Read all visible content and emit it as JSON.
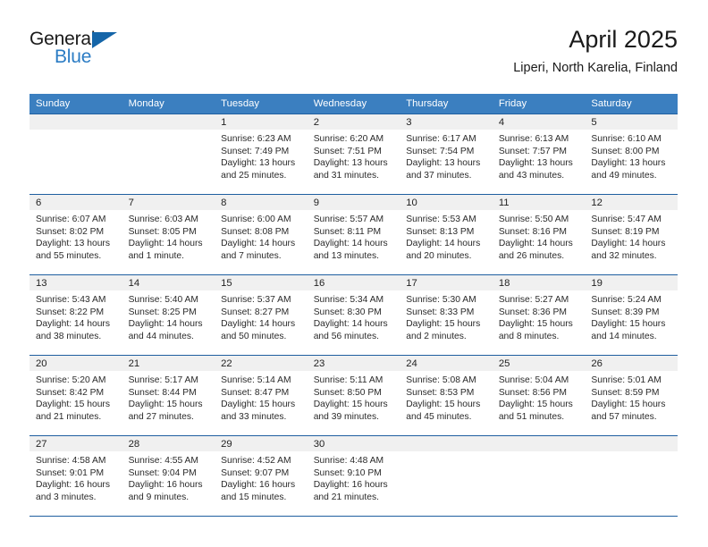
{
  "brand": {
    "name_part1": "General",
    "name_part2": "Blue",
    "triangle_icon": "triangle-icon",
    "accent_blue": "#2b7cc4",
    "triangle_blue": "#1565a8"
  },
  "header": {
    "title": "April 2025",
    "subtitle": "Liperi, North Karelia, Finland"
  },
  "calendar": {
    "header_bg": "#3b7fc0",
    "row_border": "#1f5fa0",
    "daynum_bg": "#f0f0f0",
    "weekdays": [
      "Sunday",
      "Monday",
      "Tuesday",
      "Wednesday",
      "Thursday",
      "Friday",
      "Saturday"
    ],
    "weeks": [
      [
        {
          "day": "",
          "sunrise": "",
          "sunset": "",
          "daylight1": "",
          "daylight2": ""
        },
        {
          "day": "",
          "sunrise": "",
          "sunset": "",
          "daylight1": "",
          "daylight2": ""
        },
        {
          "day": "1",
          "sunrise": "Sunrise: 6:23 AM",
          "sunset": "Sunset: 7:49 PM",
          "daylight1": "Daylight: 13 hours",
          "daylight2": "and 25 minutes."
        },
        {
          "day": "2",
          "sunrise": "Sunrise: 6:20 AM",
          "sunset": "Sunset: 7:51 PM",
          "daylight1": "Daylight: 13 hours",
          "daylight2": "and 31 minutes."
        },
        {
          "day": "3",
          "sunrise": "Sunrise: 6:17 AM",
          "sunset": "Sunset: 7:54 PM",
          "daylight1": "Daylight: 13 hours",
          "daylight2": "and 37 minutes."
        },
        {
          "day": "4",
          "sunrise": "Sunrise: 6:13 AM",
          "sunset": "Sunset: 7:57 PM",
          "daylight1": "Daylight: 13 hours",
          "daylight2": "and 43 minutes."
        },
        {
          "day": "5",
          "sunrise": "Sunrise: 6:10 AM",
          "sunset": "Sunset: 8:00 PM",
          "daylight1": "Daylight: 13 hours",
          "daylight2": "and 49 minutes."
        }
      ],
      [
        {
          "day": "6",
          "sunrise": "Sunrise: 6:07 AM",
          "sunset": "Sunset: 8:02 PM",
          "daylight1": "Daylight: 13 hours",
          "daylight2": "and 55 minutes."
        },
        {
          "day": "7",
          "sunrise": "Sunrise: 6:03 AM",
          "sunset": "Sunset: 8:05 PM",
          "daylight1": "Daylight: 14 hours",
          "daylight2": "and 1 minute."
        },
        {
          "day": "8",
          "sunrise": "Sunrise: 6:00 AM",
          "sunset": "Sunset: 8:08 PM",
          "daylight1": "Daylight: 14 hours",
          "daylight2": "and 7 minutes."
        },
        {
          "day": "9",
          "sunrise": "Sunrise: 5:57 AM",
          "sunset": "Sunset: 8:11 PM",
          "daylight1": "Daylight: 14 hours",
          "daylight2": "and 13 minutes."
        },
        {
          "day": "10",
          "sunrise": "Sunrise: 5:53 AM",
          "sunset": "Sunset: 8:13 PM",
          "daylight1": "Daylight: 14 hours",
          "daylight2": "and 20 minutes."
        },
        {
          "day": "11",
          "sunrise": "Sunrise: 5:50 AM",
          "sunset": "Sunset: 8:16 PM",
          "daylight1": "Daylight: 14 hours",
          "daylight2": "and 26 minutes."
        },
        {
          "day": "12",
          "sunrise": "Sunrise: 5:47 AM",
          "sunset": "Sunset: 8:19 PM",
          "daylight1": "Daylight: 14 hours",
          "daylight2": "and 32 minutes."
        }
      ],
      [
        {
          "day": "13",
          "sunrise": "Sunrise: 5:43 AM",
          "sunset": "Sunset: 8:22 PM",
          "daylight1": "Daylight: 14 hours",
          "daylight2": "and 38 minutes."
        },
        {
          "day": "14",
          "sunrise": "Sunrise: 5:40 AM",
          "sunset": "Sunset: 8:25 PM",
          "daylight1": "Daylight: 14 hours",
          "daylight2": "and 44 minutes."
        },
        {
          "day": "15",
          "sunrise": "Sunrise: 5:37 AM",
          "sunset": "Sunset: 8:27 PM",
          "daylight1": "Daylight: 14 hours",
          "daylight2": "and 50 minutes."
        },
        {
          "day": "16",
          "sunrise": "Sunrise: 5:34 AM",
          "sunset": "Sunset: 8:30 PM",
          "daylight1": "Daylight: 14 hours",
          "daylight2": "and 56 minutes."
        },
        {
          "day": "17",
          "sunrise": "Sunrise: 5:30 AM",
          "sunset": "Sunset: 8:33 PM",
          "daylight1": "Daylight: 15 hours",
          "daylight2": "and 2 minutes."
        },
        {
          "day": "18",
          "sunrise": "Sunrise: 5:27 AM",
          "sunset": "Sunset: 8:36 PM",
          "daylight1": "Daylight: 15 hours",
          "daylight2": "and 8 minutes."
        },
        {
          "day": "19",
          "sunrise": "Sunrise: 5:24 AM",
          "sunset": "Sunset: 8:39 PM",
          "daylight1": "Daylight: 15 hours",
          "daylight2": "and 14 minutes."
        }
      ],
      [
        {
          "day": "20",
          "sunrise": "Sunrise: 5:20 AM",
          "sunset": "Sunset: 8:42 PM",
          "daylight1": "Daylight: 15 hours",
          "daylight2": "and 21 minutes."
        },
        {
          "day": "21",
          "sunrise": "Sunrise: 5:17 AM",
          "sunset": "Sunset: 8:44 PM",
          "daylight1": "Daylight: 15 hours",
          "daylight2": "and 27 minutes."
        },
        {
          "day": "22",
          "sunrise": "Sunrise: 5:14 AM",
          "sunset": "Sunset: 8:47 PM",
          "daylight1": "Daylight: 15 hours",
          "daylight2": "and 33 minutes."
        },
        {
          "day": "23",
          "sunrise": "Sunrise: 5:11 AM",
          "sunset": "Sunset: 8:50 PM",
          "daylight1": "Daylight: 15 hours",
          "daylight2": "and 39 minutes."
        },
        {
          "day": "24",
          "sunrise": "Sunrise: 5:08 AM",
          "sunset": "Sunset: 8:53 PM",
          "daylight1": "Daylight: 15 hours",
          "daylight2": "and 45 minutes."
        },
        {
          "day": "25",
          "sunrise": "Sunrise: 5:04 AM",
          "sunset": "Sunset: 8:56 PM",
          "daylight1": "Daylight: 15 hours",
          "daylight2": "and 51 minutes."
        },
        {
          "day": "26",
          "sunrise": "Sunrise: 5:01 AM",
          "sunset": "Sunset: 8:59 PM",
          "daylight1": "Daylight: 15 hours",
          "daylight2": "and 57 minutes."
        }
      ],
      [
        {
          "day": "27",
          "sunrise": "Sunrise: 4:58 AM",
          "sunset": "Sunset: 9:01 PM",
          "daylight1": "Daylight: 16 hours",
          "daylight2": "and 3 minutes."
        },
        {
          "day": "28",
          "sunrise": "Sunrise: 4:55 AM",
          "sunset": "Sunset: 9:04 PM",
          "daylight1": "Daylight: 16 hours",
          "daylight2": "and 9 minutes."
        },
        {
          "day": "29",
          "sunrise": "Sunrise: 4:52 AM",
          "sunset": "Sunset: 9:07 PM",
          "daylight1": "Daylight: 16 hours",
          "daylight2": "and 15 minutes."
        },
        {
          "day": "30",
          "sunrise": "Sunrise: 4:48 AM",
          "sunset": "Sunset: 9:10 PM",
          "daylight1": "Daylight: 16 hours",
          "daylight2": "and 21 minutes."
        },
        {
          "day": "",
          "sunrise": "",
          "sunset": "",
          "daylight1": "",
          "daylight2": ""
        },
        {
          "day": "",
          "sunrise": "",
          "sunset": "",
          "daylight1": "",
          "daylight2": ""
        },
        {
          "day": "",
          "sunrise": "",
          "sunset": "",
          "daylight1": "",
          "daylight2": ""
        }
      ]
    ]
  }
}
